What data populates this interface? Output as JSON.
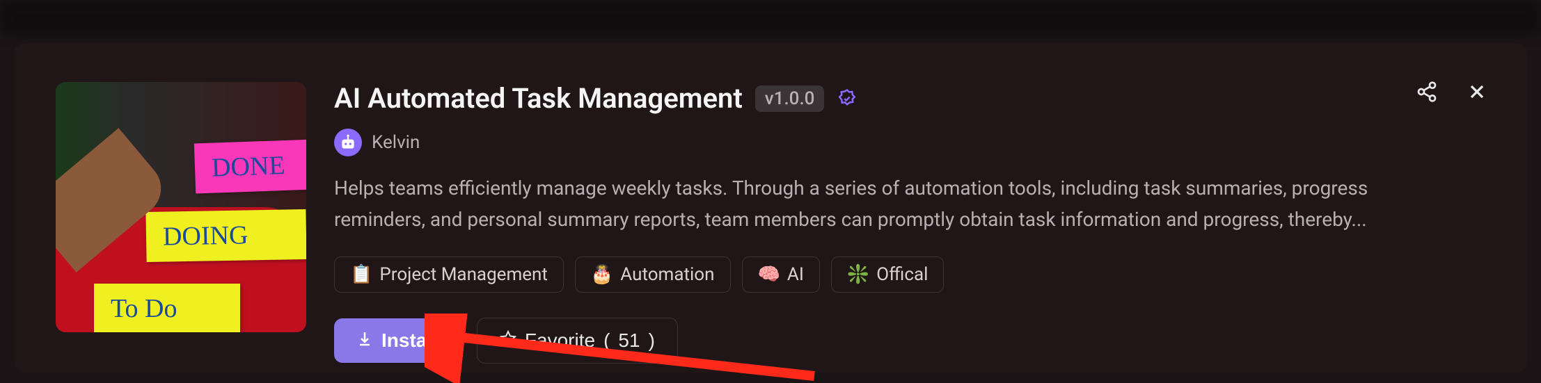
{
  "title": "AI Automated Task Management",
  "version": "v1.0.0",
  "author": "Kelvin",
  "description": "Helps teams efficiently manage weekly tasks. Through a series of automation tools, including task summaries, progress reminders, and personal summary reports, team members can promptly obtain task information and progress, thereby...",
  "tags": [
    {
      "emoji": "📋",
      "label": "Project Management"
    },
    {
      "emoji": "🎂",
      "label": "Automation"
    },
    {
      "emoji": "🧠",
      "label": "AI"
    },
    {
      "emoji": "❇️",
      "label": "Offical"
    }
  ],
  "buttons": {
    "install": "Install",
    "favorite": "Favorite",
    "favorite_count": "51"
  },
  "thumbnail": {
    "sticky_done": "DONE",
    "sticky_doing": "DOING",
    "sticky_todo": "To Do"
  },
  "colors": {
    "accent": "#8a78e8",
    "verified": "#8a6aff"
  }
}
